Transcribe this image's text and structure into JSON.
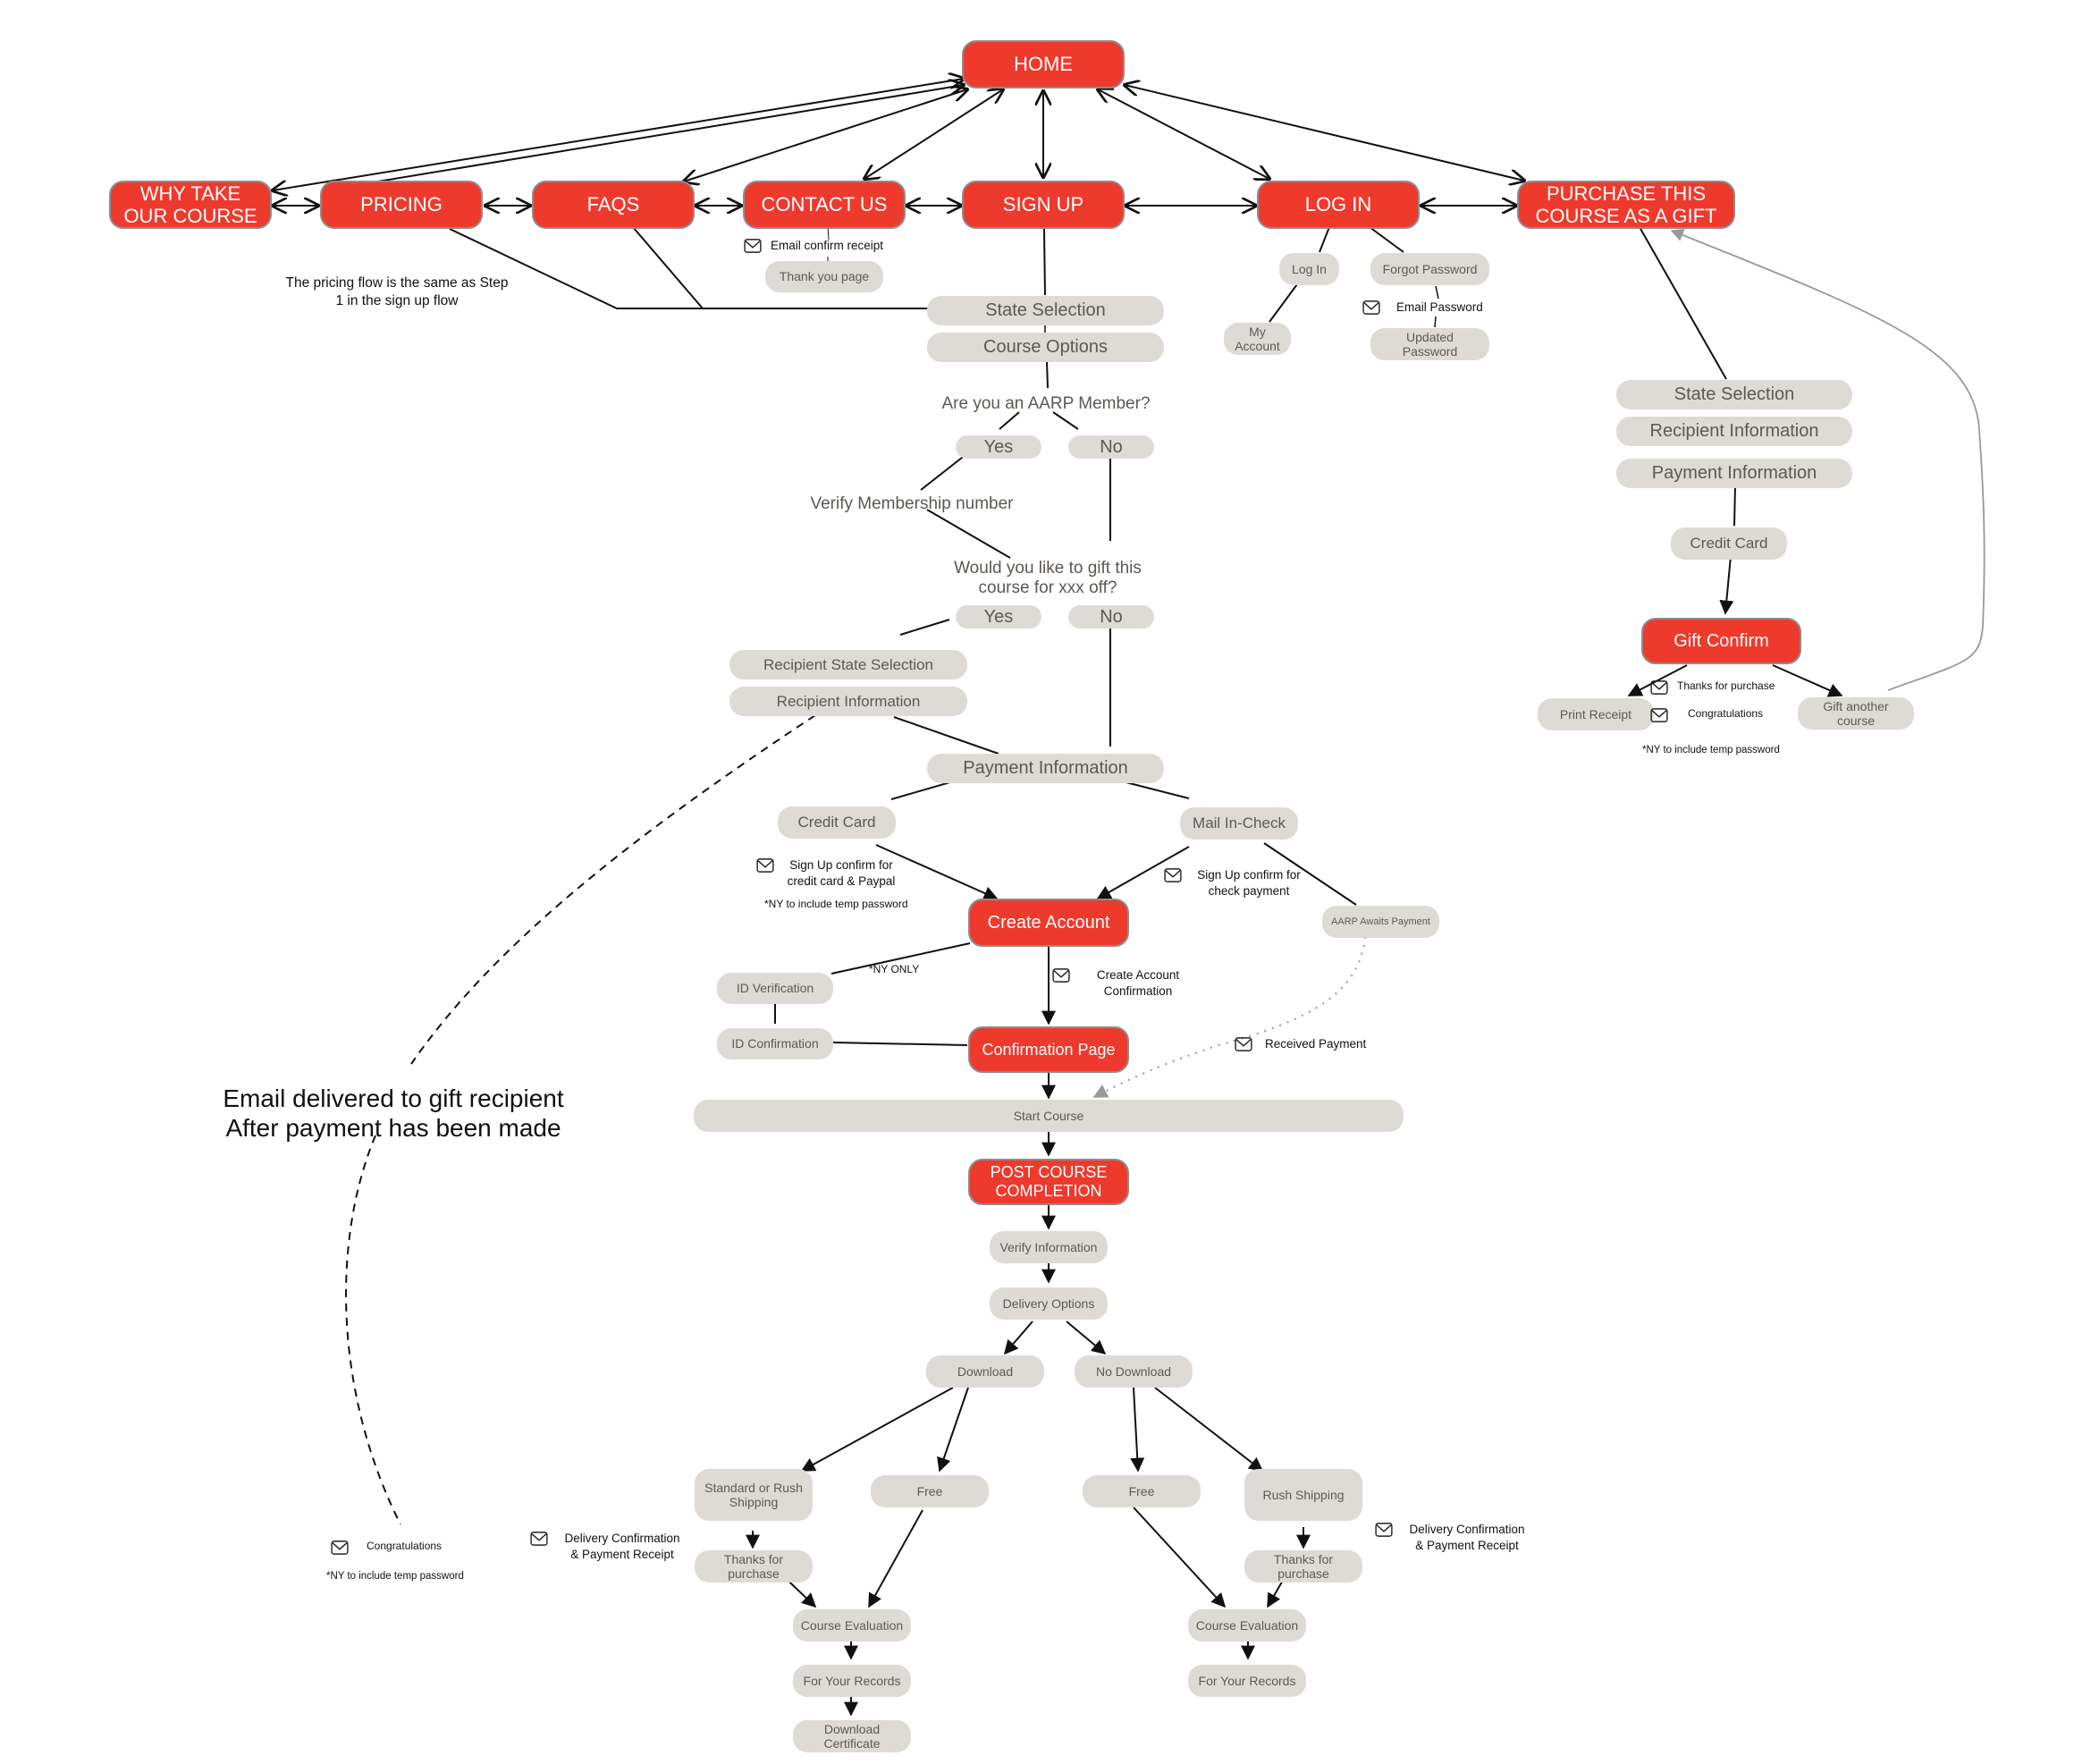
{
  "colors": {
    "primary_page": "#ee3a2d",
    "step": "#dedbd6",
    "step_text": "#5c5853",
    "connector": "#111111",
    "loop_connector": "#999999"
  },
  "top_nav": {
    "home": "HOME",
    "why": "WHY TAKE OUR COURSE",
    "pricing": "PRICING",
    "faqs": "FAQS",
    "contact": "CONTACT US",
    "signup": "SIGN UP",
    "login": "LOG IN",
    "gift": "PURCHASE THIS COURSE AS A GIFT"
  },
  "contact_flow": {
    "email": "Email confirm receipt",
    "thank_you": "Thank you page"
  },
  "pricing_note": "The pricing flow is the same as Step 1 in the sign up flow",
  "login_flow": {
    "login": "Log In",
    "forgot": "Forgot Password",
    "my_account": "My Account",
    "email_password": "Email Password",
    "updated_password": "Updated Password"
  },
  "signup_flow": {
    "state_selection": "State Selection",
    "course_options": "Course Options",
    "aarp_question": "Are you an AARP Member?",
    "yes": "Yes",
    "no": "No",
    "verify_membership": "Verify Membership number",
    "gift_question": "Would you like to gift this course for xxx off?",
    "recipient_state": "Recipient State Selection",
    "recipient_info": "Recipient Information",
    "payment_info": "Payment Information",
    "credit_card": "Credit Card",
    "mail_check": "Mail In-Check",
    "email_cc": "Sign Up confirm for credit card & Paypal",
    "ny_note": "*NY to include temp password",
    "email_check": "Sign Up confirm for check payment",
    "aarp_awaits": "AARP Awaits Payment",
    "create_account": "Create Account",
    "ny_only": "*NY ONLY",
    "id_verification": "ID Verification",
    "id_confirmation": "ID Confirmation",
    "email_create": "Create Account Confirmation",
    "confirmation_page": "Confirmation Page",
    "received_payment": "Received Payment",
    "start_course": "Start Course"
  },
  "gift_flow": {
    "state_selection": "State Selection",
    "recipient_info": "Recipient Information",
    "payment_info": "Payment Information",
    "credit_card": "Credit Card",
    "gift_confirm": "Gift Confirm",
    "print_receipt": "Print Receipt",
    "thanks_email": "Thanks for purchase",
    "congrats_email": "Congratulations",
    "gift_another": "Gift another course",
    "ny_note": "*NY to include temp password"
  },
  "gift_recipient_note": "Email delivered to gift recipient After payment has been made",
  "gift_recipient_email": {
    "congrats": "Congratulations",
    "ny_note": "*NY to include temp password"
  },
  "post_course": {
    "title": "POST COURSE COMPLETION",
    "verify": "Verify Information",
    "delivery": "Delivery Options",
    "download": "Download",
    "no_download": "No Download",
    "std_rush": "Standard or Rush Shipping",
    "free_left": "Free",
    "free_right": "Free",
    "rush": "Rush Shipping",
    "thanks_left": "Thanks for purchase",
    "thanks_right": "Thanks for purchase",
    "email_left": "Delivery Confirmation & Payment Receipt",
    "email_right": "Delivery Confirmation & Payment Receipt",
    "eval_left": "Course Evaluation",
    "eval_right": "Course Evaluation",
    "records_left": "For Your Records",
    "records_right": "For Your Records",
    "certificate": "Download Certificate"
  }
}
